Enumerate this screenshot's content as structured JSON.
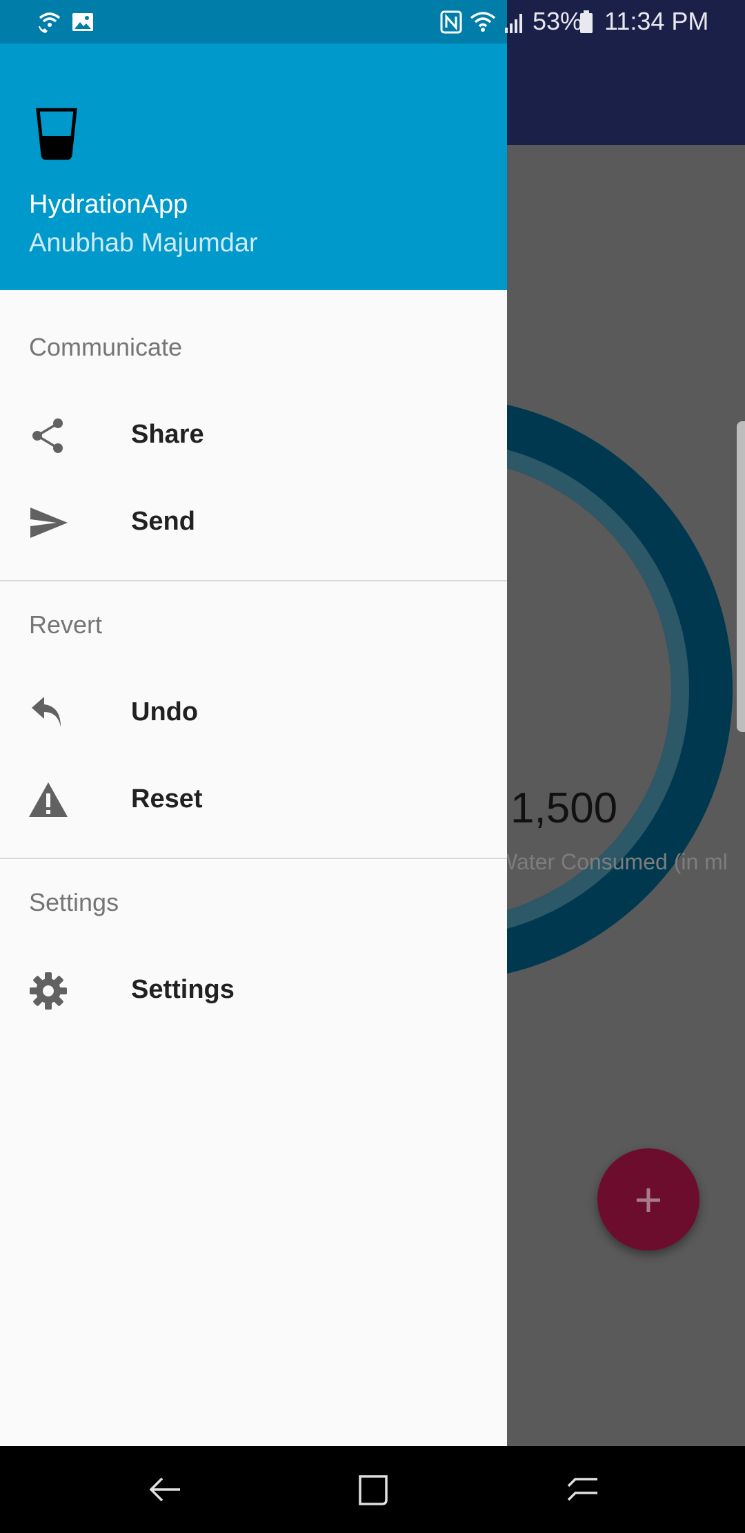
{
  "status_bar": {
    "battery": "53%",
    "time": "11:34 PM"
  },
  "drawer": {
    "header": {
      "title": "HydrationApp",
      "subtitle": "Anubhab Majumdar",
      "logo_icon": "water-glass-icon"
    },
    "sections": [
      {
        "title": "Communicate",
        "items": [
          {
            "label": "Share",
            "icon": "share-icon"
          },
          {
            "label": "Send",
            "icon": "send-icon"
          }
        ]
      },
      {
        "title": "Revert",
        "items": [
          {
            "label": "Undo",
            "icon": "undo-icon"
          },
          {
            "label": "Reset",
            "icon": "warning-icon"
          }
        ]
      },
      {
        "title": "Settings",
        "items": [
          {
            "label": "Settings",
            "icon": "gear-icon"
          }
        ]
      }
    ]
  },
  "background_app": {
    "consumed_value": "1,500",
    "consumed_label": "Water Consumed (in ml",
    "fab_label": "+"
  },
  "colors": {
    "drawer_header": "#0099cc",
    "toolbar": "#1b2049",
    "progress_ring": "#00394f",
    "fab": "#6d0d2e"
  }
}
